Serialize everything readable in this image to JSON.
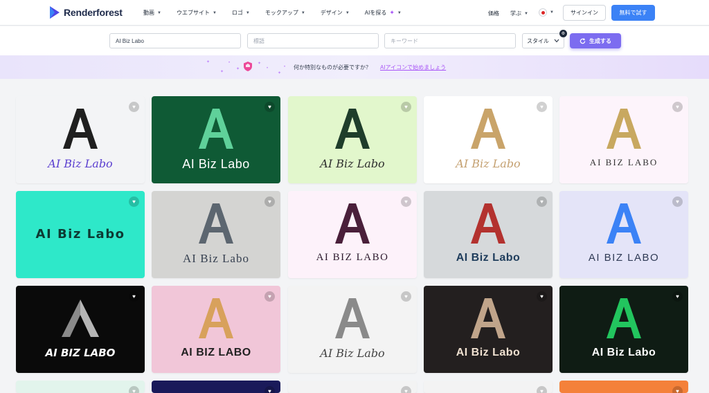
{
  "header": {
    "brand": "Renderforest",
    "nav": [
      {
        "label": "動画",
        "caret": true
      },
      {
        "label": "ウエブサイト",
        "caret": true
      },
      {
        "label": "ロゴ",
        "caret": true
      },
      {
        "label": "モックアップ",
        "caret": true
      },
      {
        "label": "デザイン",
        "caret": true
      },
      {
        "label": "AIを探る",
        "caret": true,
        "sparkle": true
      }
    ],
    "pricing": "価格",
    "learn": "学ぶ",
    "signin": "サインイン",
    "free_trial": "無料で試す"
  },
  "search": {
    "name_value": "AI Biz Labo",
    "slogan_placeholder": "標語",
    "keyword_placeholder": "キーワード",
    "style_label": "スタイル",
    "generate_label": "生成する"
  },
  "banner": {
    "question": "何か特別なものが必要ですか？",
    "link": "AIアイコンで始めましょう"
  },
  "cards": [
    {
      "bg": "#f3f4f6",
      "text": "AI Biz Labo",
      "style": "script",
      "textColor": "#5b3fd0",
      "mono": "A",
      "monoColor": "#1f1f1f"
    },
    {
      "bg": "#0f5a35",
      "text": "AI Biz Labo",
      "style": "sans",
      "textColor": "#ffffff",
      "mono": "A",
      "monoColor": "#5fd19a"
    },
    {
      "bg": "#e2f7cc",
      "text": "AI Biz Labo",
      "style": "script",
      "textColor": "#2f2f2f",
      "mono": "A",
      "monoColor": "#1f3d2b"
    },
    {
      "bg": "#ffffff",
      "text": "AI Biz Labo",
      "style": "script",
      "textColor": "#c4a070",
      "mono": "A",
      "monoColor": "#c9a46a"
    },
    {
      "bg": "#fdf4fb",
      "text": "AI BIZ LABO",
      "style": "spaced",
      "textColor": "#333333",
      "mono": "A",
      "monoColor": "#c8a860"
    },
    {
      "bg": "#2ee8c9",
      "text": "AI Biz Labo",
      "style": "round",
      "textColor": "#0d3a33",
      "mono": "",
      "monoColor": ""
    },
    {
      "bg": "#d4d4d2",
      "text": "AI Biz Labo",
      "style": "serifcaps",
      "textColor": "#374151",
      "mono": "A",
      "monoColor": "#5c6670"
    },
    {
      "bg": "#fdf2fa",
      "text": "AI BIZ LABO",
      "style": "serif",
      "textColor": "#2d1a2e",
      "mono": "A",
      "monoColor": "#4a1f3a"
    },
    {
      "bg": "#d6d9db",
      "text": "AI Biz Labo",
      "style": "bold",
      "textColor": "#1f3d5c",
      "mono": "A",
      "monoColor": "#b3322f"
    },
    {
      "bg": "#e4e4f8",
      "text": "AI BIZ LABO",
      "style": "light",
      "textColor": "#2f3a55",
      "mono": "A",
      "monoColor": "#3b82f6"
    },
    {
      "bg": "#0a0a0a",
      "text": "AI BIZ LABO",
      "style": "heavy",
      "textColor": "#ffffff",
      "mono": "^",
      "monoColor": "#8a8a8a"
    },
    {
      "bg": "#f1c6d8",
      "text": "AI BIZ LABO",
      "style": "bold",
      "textColor": "#222222",
      "mono": "A",
      "monoColor": "#d8a15c"
    },
    {
      "bg": "#f3f3f3",
      "text": "AI Biz Labo",
      "style": "script",
      "textColor": "#444444",
      "mono": "A",
      "monoColor": "#8a8a8a"
    },
    {
      "bg": "#231f1f",
      "text": "AI Biz Labo",
      "style": "bold",
      "textColor": "#efe0d0",
      "mono": "A",
      "monoColor": "#c0a48a"
    },
    {
      "bg": "#0f1c14",
      "text": "AI Biz Labo",
      "style": "bold",
      "textColor": "#ffffff",
      "mono": "A",
      "monoColor": "#22c55e"
    }
  ],
  "partial_cards": [
    {
      "bg": "#e2f4ec"
    },
    {
      "bg": "#1a1a5a"
    },
    {
      "bg": "#f3f3f3"
    },
    {
      "bg": "#f3f3f3"
    },
    {
      "bg": "#f4813a"
    }
  ]
}
